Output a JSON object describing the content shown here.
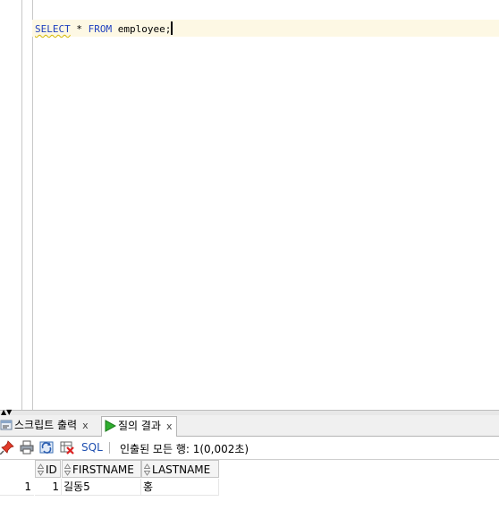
{
  "editor": {
    "sql": {
      "select": "SELECT",
      "star": " * ",
      "from": "FROM",
      "rest": " employee;"
    }
  },
  "tabs": {
    "script_output": {
      "label": "스크립트 출력",
      "close": "x"
    },
    "query_result": {
      "label": "질의 결과",
      "close": "x"
    }
  },
  "toolbar": {
    "sql_label": "SQL",
    "status": "인출된 모든 행: 1(0,002초)"
  },
  "grid": {
    "columns": [
      "ID",
      "FIRSTNAME",
      "LASTNAME"
    ],
    "rows": [
      {
        "row_num": "1",
        "cells": [
          "1",
          "길동5",
          "홍"
        ]
      }
    ]
  },
  "colors": {
    "keyword": "#1f3fbf",
    "current_line": "#fdf8e4",
    "link": "#1f4fb0"
  }
}
